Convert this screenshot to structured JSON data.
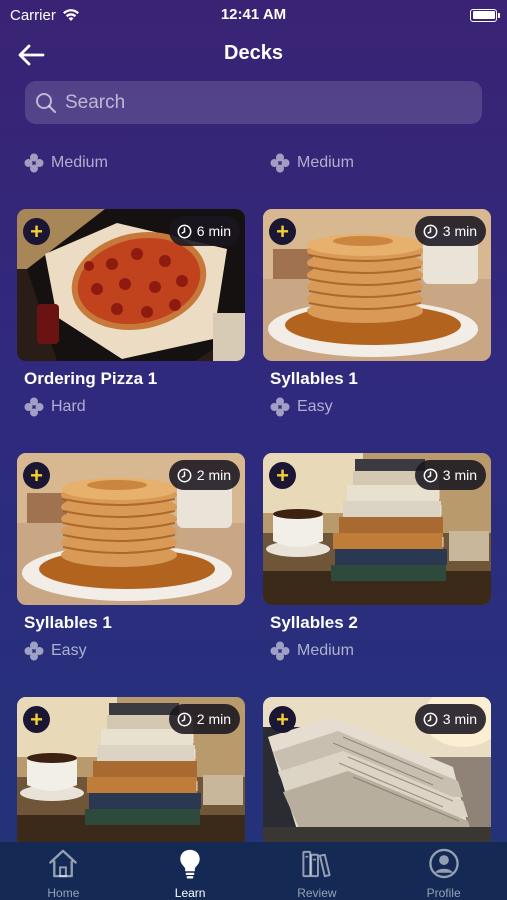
{
  "status": {
    "carrier": "Carrier",
    "time": "12:41 AM"
  },
  "header": {
    "title": "Decks"
  },
  "search": {
    "placeholder": "Search"
  },
  "peek_row": [
    {
      "difficulty": "Medium"
    },
    {
      "difficulty": "Medium"
    }
  ],
  "decks": [
    {
      "title": "Ordering Pizza 1",
      "difficulty": "Hard",
      "duration": "6 min",
      "image": "pizza"
    },
    {
      "title": "Syllables 1",
      "difficulty": "Easy",
      "duration": "3 min",
      "image": "pancakes"
    },
    {
      "title": "Syllables 1",
      "difficulty": "Easy",
      "duration": "2 min",
      "image": "pancakes"
    },
    {
      "title": "Syllables 2",
      "difficulty": "Medium",
      "duration": "3 min",
      "image": "books"
    },
    {
      "title": "",
      "difficulty": "",
      "duration": "2 min",
      "image": "books"
    },
    {
      "title": "",
      "difficulty": "",
      "duration": "3 min",
      "image": "newspapers"
    }
  ],
  "tabs": [
    {
      "label": "Home",
      "icon": "home-icon",
      "active": false
    },
    {
      "label": "Learn",
      "icon": "lightbulb-icon",
      "active": true
    },
    {
      "label": "Review",
      "icon": "books-icon",
      "active": false
    },
    {
      "label": "Profile",
      "icon": "profile-icon",
      "active": false
    }
  ],
  "colors": {
    "accent_yellow": "#f3cf33",
    "tab_bar": "#142a55",
    "bg_top": "#3a2374",
    "bg_bottom": "#23337a"
  }
}
